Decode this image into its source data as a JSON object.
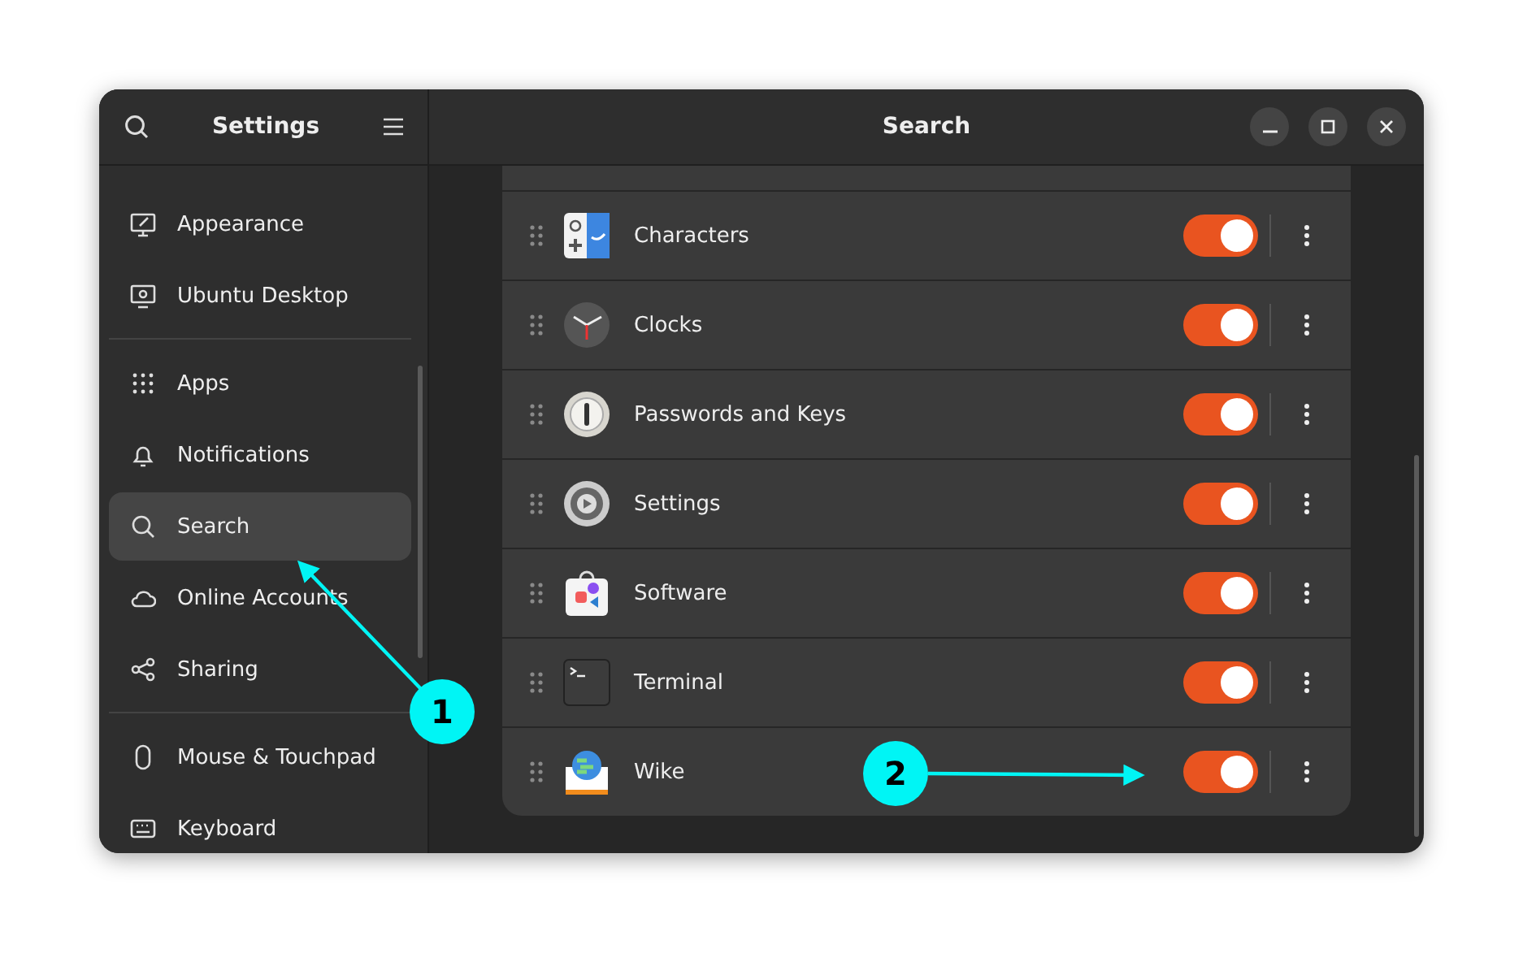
{
  "sidebar": {
    "title": "Settings",
    "groups": [
      {
        "items": [
          {
            "label": "Appearance",
            "selected": false
          },
          {
            "label": "Ubuntu Desktop",
            "selected": false
          }
        ]
      },
      {
        "items": [
          {
            "label": "Apps",
            "selected": false
          },
          {
            "label": "Notifications",
            "selected": false
          },
          {
            "label": "Search",
            "selected": true
          },
          {
            "label": "Online Accounts",
            "selected": false
          },
          {
            "label": "Sharing",
            "selected": false
          }
        ]
      },
      {
        "items": [
          {
            "label": "Mouse & Touchpad",
            "selected": false
          },
          {
            "label": "Keyboard",
            "selected": false
          }
        ]
      }
    ]
  },
  "main": {
    "title": "Search",
    "apps": [
      {
        "name": "Characters",
        "on": true
      },
      {
        "name": "Clocks",
        "on": true
      },
      {
        "name": "Passwords and Keys",
        "on": true
      },
      {
        "name": "Settings",
        "on": true
      },
      {
        "name": "Software",
        "on": true
      },
      {
        "name": "Terminal",
        "on": true
      },
      {
        "name": "Wike",
        "on": true
      }
    ]
  },
  "annotations": [
    {
      "label": "1"
    },
    {
      "label": "2"
    }
  ]
}
